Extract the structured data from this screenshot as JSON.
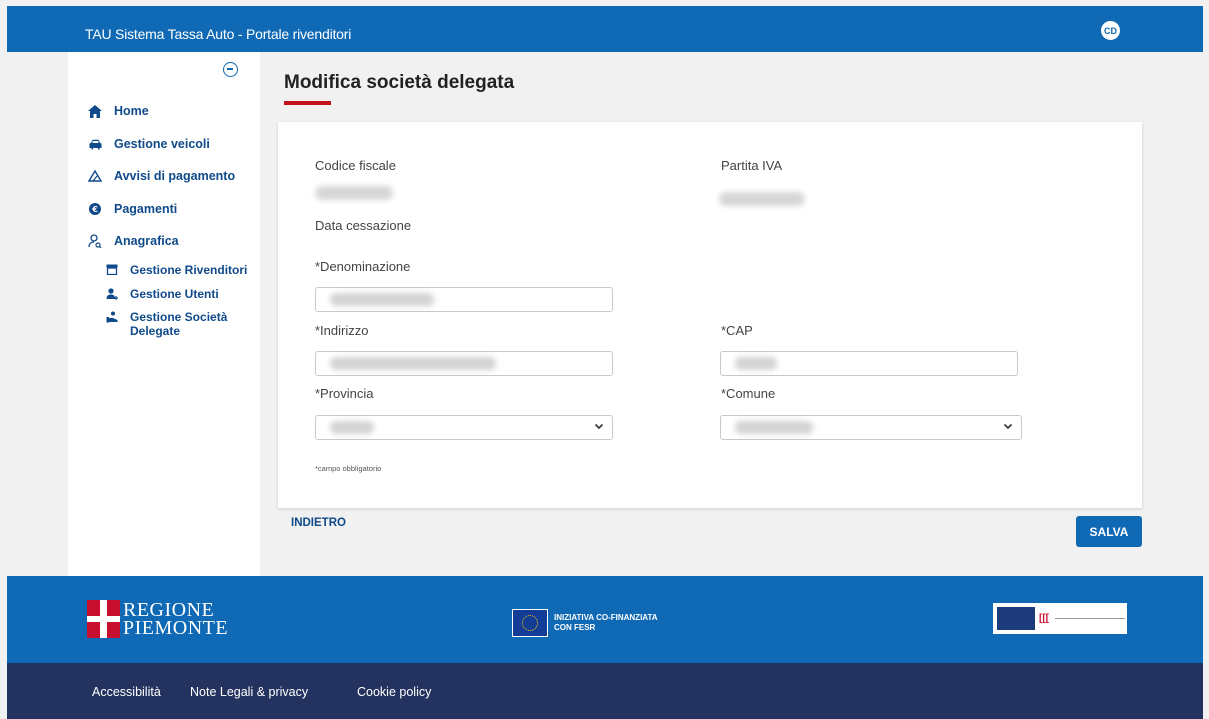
{
  "header": {
    "title": "TAU Sistema Tassa Auto - Portale rivenditori",
    "avatar_initials": "CD"
  },
  "sidebar": {
    "items": [
      {
        "label": "Home",
        "icon": "home-icon"
      },
      {
        "label": "Gestione veicoli",
        "icon": "car-icon"
      },
      {
        "label": "Avvisi di pagamento",
        "icon": "warning-icon"
      },
      {
        "label": "Pagamenti",
        "icon": "euro-icon"
      },
      {
        "label": "Anagrafica",
        "icon": "user-search-icon"
      }
    ],
    "subitems": [
      {
        "label": "Gestione Rivenditori",
        "icon": "store-icon"
      },
      {
        "label": "Gestione Utenti",
        "icon": "user-add-icon"
      },
      {
        "label": "Gestione Società Delegate",
        "icon": "handshake-icon"
      }
    ]
  },
  "page": {
    "title": "Modifica società delegata"
  },
  "form": {
    "codice_fiscale_label": "Codice fiscale",
    "partita_iva_label": "Partita IVA",
    "data_cessazione_label": "Data cessazione",
    "denominazione_label": "*Denominazione",
    "indirizzo_label": "*Indirizzo",
    "cap_label": "*CAP",
    "provincia_label": "*Provincia",
    "comune_label": "*Comune",
    "required_note": "*campo obbligatorio"
  },
  "actions": {
    "back_label": "INDIETRO",
    "save_label": "SALVA"
  },
  "footer": {
    "regione_line1": "REGIONE",
    "regione_line2": "PIEMONTE",
    "eu_line1": "INIZIATIVA CO-FINANZIATA",
    "eu_line2": "CON FESR",
    "links": [
      "Accessibilità",
      "Note Legali & privacy",
      "Cookie policy"
    ]
  },
  "colors": {
    "primary": "#0f69b4",
    "accent_red": "#c3111e",
    "footer_dark": "#23325f"
  }
}
